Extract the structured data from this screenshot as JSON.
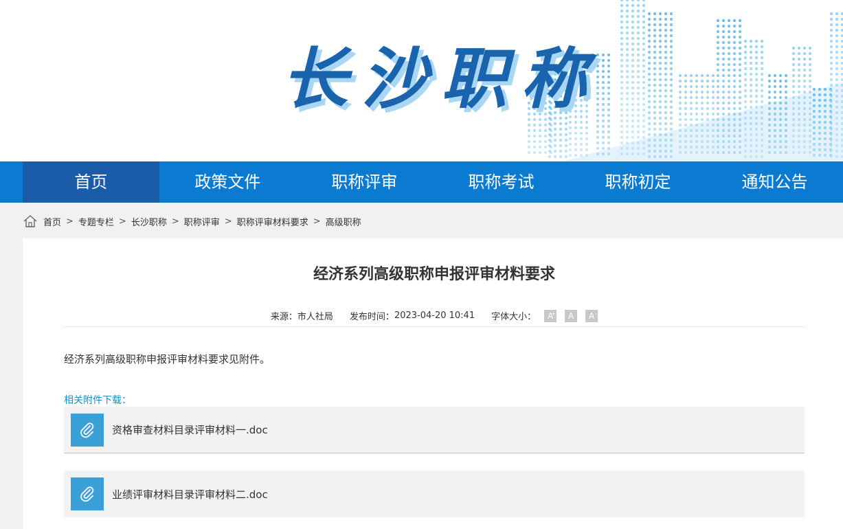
{
  "banner": {
    "title": "长沙职称"
  },
  "nav": {
    "items": [
      {
        "label": "首页",
        "active": true
      },
      {
        "label": "政策文件"
      },
      {
        "label": "职称评审"
      },
      {
        "label": "职称考试"
      },
      {
        "label": "职称初定"
      },
      {
        "label": "通知公告"
      }
    ]
  },
  "breadcrumb": {
    "items": [
      "首页",
      "专题专栏",
      "长沙职称",
      "职称评审",
      "职称评审材料要求",
      "高级职称"
    ],
    "separator": ">"
  },
  "article": {
    "title": "经济系列高级职称申报评审材料要求",
    "source_label": "来源：",
    "source": "市人社局",
    "date_label": "发布时间：",
    "date": "2023-04-20 10:41",
    "font_size_label": "字体大小：",
    "font_buttons": [
      "A",
      "A",
      "A"
    ],
    "body": "经济系列高级职称申报评审材料要求见附件。",
    "attachments_label": "相关附件下载：",
    "attachments": [
      {
        "name": "资格审查材料目录评审材料一.doc"
      },
      {
        "name": "业绩评审材料目录评审材料二.doc"
      }
    ]
  },
  "colors": {
    "nav_bg": "#0b7bd1",
    "nav_active": "#1a5ca8",
    "title_blue": "#1a63ad",
    "attach_icon": "#3aa0d8",
    "link_blue": "#1b8fc4"
  }
}
